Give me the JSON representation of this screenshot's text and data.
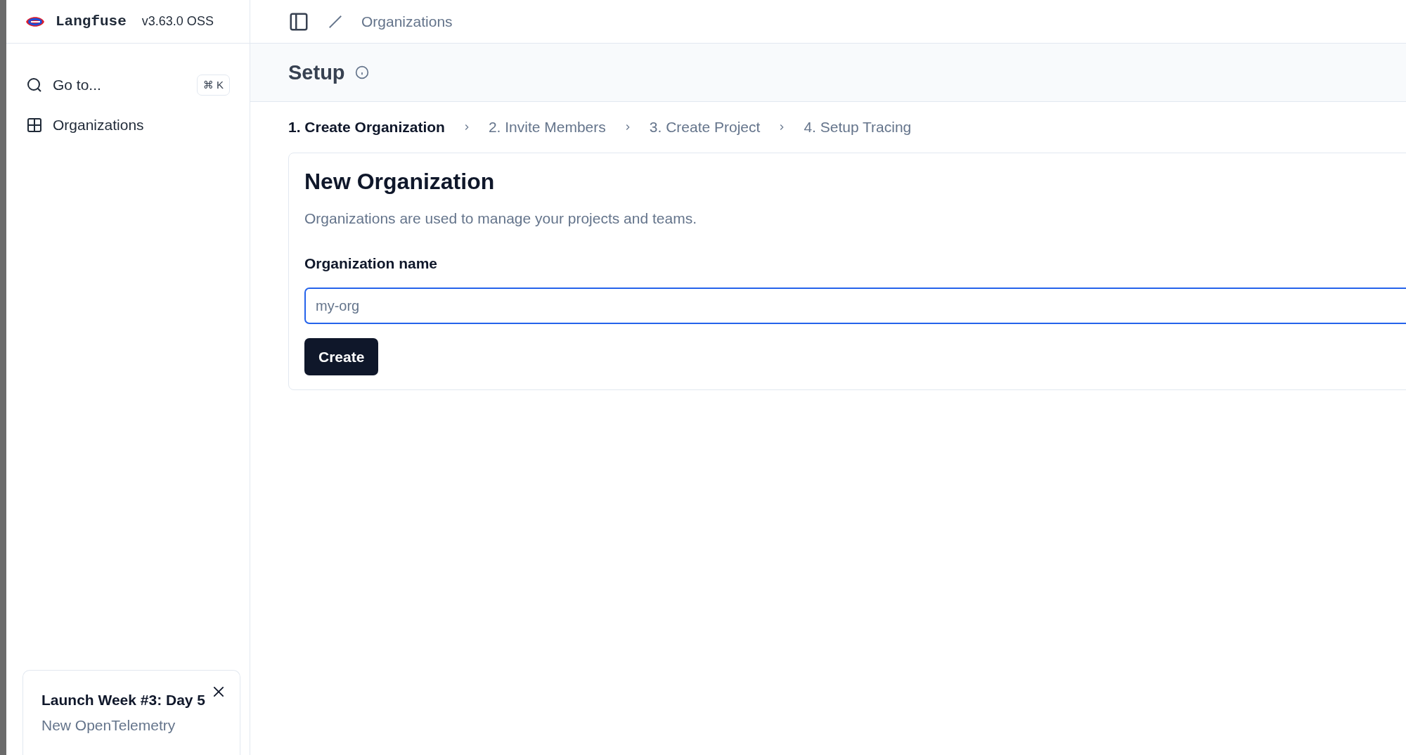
{
  "sidebar": {
    "brand": "Langfuse",
    "version": "v3.63.0 OSS",
    "items": [
      {
        "kind": "search",
        "label": "Go to...",
        "shortcut": "⌘ K"
      },
      {
        "kind": "link",
        "label": "Organizations"
      }
    ],
    "promo": {
      "title": "Launch Week #3: Day 5",
      "body": "New OpenTelemetry"
    }
  },
  "breadcrumb": [
    "Organizations"
  ],
  "page": {
    "title": "Setup"
  },
  "steps": [
    {
      "label": "1. Create Organization",
      "selected": true
    },
    {
      "label": "2. Invite Members",
      "selected": false
    },
    {
      "label": "3. Create Project",
      "selected": false
    },
    {
      "label": "4. Setup Tracing",
      "selected": false
    }
  ],
  "form": {
    "title": "New Organization",
    "description": "Organizations are used to manage your projects and teams.",
    "field_label": "Organization name",
    "placeholder": "my-org",
    "focused": true,
    "button": "Create"
  }
}
